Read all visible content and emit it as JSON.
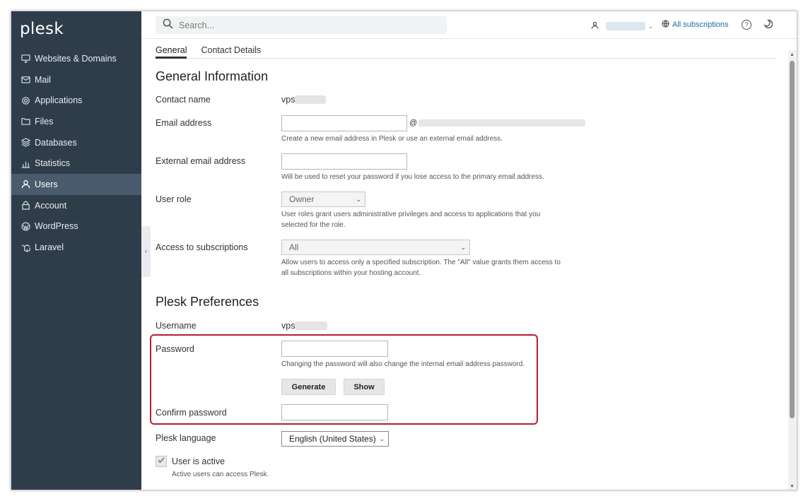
{
  "app": {
    "logo": "plesk"
  },
  "sidebar": {
    "items": [
      {
        "label": "Websites & Domains",
        "icon": "monitor-icon"
      },
      {
        "label": "Mail",
        "icon": "mail-icon"
      },
      {
        "label": "Applications",
        "icon": "gear-icon"
      },
      {
        "label": "Files",
        "icon": "folder-icon"
      },
      {
        "label": "Databases",
        "icon": "database-icon"
      },
      {
        "label": "Statistics",
        "icon": "bar-chart-icon"
      },
      {
        "label": "Users",
        "icon": "user-icon",
        "active": true
      },
      {
        "label": "Account",
        "icon": "account-icon"
      },
      {
        "label": "WordPress",
        "icon": "wordpress-icon"
      },
      {
        "label": "Laravel",
        "icon": "laravel-icon"
      }
    ]
  },
  "header": {
    "search_placeholder": "Search...",
    "subscriptions_label": "All subscriptions",
    "help_label": "?"
  },
  "tabs": [
    {
      "label": "General",
      "active": true
    },
    {
      "label": "Contact Details",
      "active": false
    }
  ],
  "general": {
    "title": "General Information",
    "contact_name_label": "Contact name",
    "contact_name_value": "vps",
    "email_label": "Email address",
    "email_at": "@",
    "email_hint": "Create a new email address in Plesk or use an external email address.",
    "external_email_label": "External email address",
    "external_email_hint": "Will be used to reset your password if you lose access to the primary email address.",
    "user_role_label": "User role",
    "user_role_value": "Owner",
    "user_role_hint_1": "User roles grant users administrative privileges and access to applications that you",
    "user_role_hint_2": "selected for the role.",
    "access_label": "Access to subscriptions",
    "access_value": "All",
    "access_hint_1": "Allow users to access only a specified subscription. The \"All\" value grants them access to",
    "access_hint_2": "all subscriptions within your hosting account."
  },
  "prefs": {
    "title": "Plesk Preferences",
    "username_label": "Username",
    "username_value": "vps",
    "password_label": "Password",
    "password_hint": "Changing the password will also change the internal email address password.",
    "generate_label": "Generate",
    "show_label": "Show",
    "confirm_label": "Confirm password",
    "language_label": "Plesk language",
    "language_value": "English (United States)",
    "active_label": "User is active",
    "active_hint": "Active users can access Plesk.",
    "active_checked": true
  },
  "colors": {
    "sidebar_bg": "#2f3d4b",
    "sidebar_active": "#495b6c",
    "link": "#1a6ea8",
    "highlight": "#b3202e"
  }
}
